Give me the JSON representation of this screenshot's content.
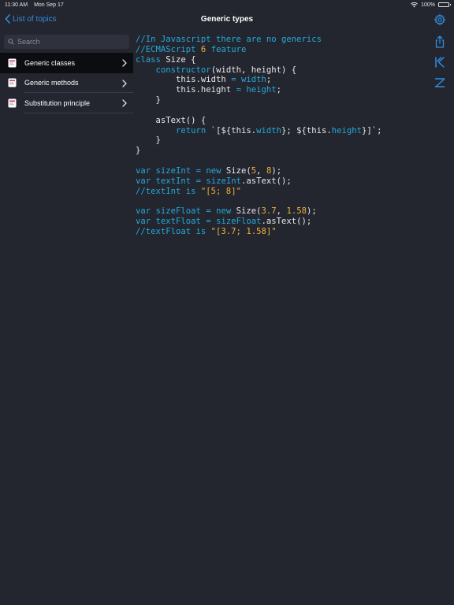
{
  "status_bar": {
    "time": "11:30 AM",
    "date": "Mon Sep 17",
    "battery": "100%"
  },
  "nav": {
    "back_label": "List of topics",
    "title": "Generic types"
  },
  "search": {
    "placeholder": "Search"
  },
  "sidebar": {
    "items": [
      {
        "label": "Generic classes",
        "selected": true
      },
      {
        "label": "Generic methods",
        "selected": false
      },
      {
        "label": "Substitution principle",
        "selected": false
      }
    ]
  },
  "code_lines": [
    [
      [
        "//In Javascript there are no generics",
        "comment"
      ]
    ],
    [
      [
        "//ECMAScript ",
        "comment"
      ],
      [
        "6",
        "num"
      ],
      [
        " feature",
        "comment"
      ]
    ],
    [
      [
        "class",
        "key"
      ],
      [
        " Size {",
        "plain"
      ]
    ],
    [
      [
        "    ",
        "plain"
      ],
      [
        "constructor",
        "key"
      ],
      [
        "(width, height) {",
        "plain"
      ]
    ],
    [
      [
        "        this.width ",
        "plain"
      ],
      [
        "=",
        "key"
      ],
      [
        " ",
        "plain"
      ],
      [
        "width",
        "key"
      ],
      [
        ";",
        "plain"
      ]
    ],
    [
      [
        "        this.height ",
        "plain"
      ],
      [
        "=",
        "key"
      ],
      [
        " ",
        "plain"
      ],
      [
        "height",
        "key"
      ],
      [
        ";",
        "plain"
      ]
    ],
    [
      [
        "    }",
        "plain"
      ]
    ],
    [
      [
        "",
        "plain"
      ]
    ],
    [
      [
        "    asText() {",
        "plain"
      ]
    ],
    [
      [
        "        ",
        "plain"
      ],
      [
        "return",
        "key"
      ],
      [
        " `[${this.",
        "plain"
      ],
      [
        "width",
        "key"
      ],
      [
        "}; ${this.",
        "plain"
      ],
      [
        "height",
        "key"
      ],
      [
        "}]`;",
        "plain"
      ]
    ],
    [
      [
        "    }",
        "plain"
      ]
    ],
    [
      [
        "}",
        "plain"
      ]
    ],
    [
      [
        "",
        "plain"
      ]
    ],
    [
      [
        "var",
        "key"
      ],
      [
        " ",
        "plain"
      ],
      [
        "sizeInt",
        "key"
      ],
      [
        " ",
        "plain"
      ],
      [
        "=",
        "key"
      ],
      [
        " ",
        "plain"
      ],
      [
        "new",
        "key"
      ],
      [
        " Size(",
        "plain"
      ],
      [
        "5",
        "num"
      ],
      [
        ", ",
        "plain"
      ],
      [
        "8",
        "num"
      ],
      [
        ");",
        "plain"
      ]
    ],
    [
      [
        "var",
        "key"
      ],
      [
        " ",
        "plain"
      ],
      [
        "textInt",
        "key"
      ],
      [
        " ",
        "plain"
      ],
      [
        "=",
        "key"
      ],
      [
        " ",
        "plain"
      ],
      [
        "sizeInt",
        "key"
      ],
      [
        ".asText();",
        "plain"
      ]
    ],
    [
      [
        "//textInt is ",
        "comment"
      ],
      [
        "\"[5; 8]\"",
        "str"
      ]
    ],
    [
      [
        "",
        "plain"
      ]
    ],
    [
      [
        "var",
        "key"
      ],
      [
        " ",
        "plain"
      ],
      [
        "sizeFloat",
        "key"
      ],
      [
        " ",
        "plain"
      ],
      [
        "=",
        "key"
      ],
      [
        " ",
        "plain"
      ],
      [
        "new",
        "key"
      ],
      [
        " Size(",
        "plain"
      ],
      [
        "3.7",
        "num"
      ],
      [
        ", ",
        "plain"
      ],
      [
        "1.58",
        "num"
      ],
      [
        ");",
        "plain"
      ]
    ],
    [
      [
        "var",
        "key"
      ],
      [
        " ",
        "plain"
      ],
      [
        "textFloat",
        "key"
      ],
      [
        " ",
        "plain"
      ],
      [
        "=",
        "key"
      ],
      [
        " ",
        "plain"
      ],
      [
        "sizeFloat",
        "key"
      ],
      [
        ".asText();",
        "plain"
      ]
    ],
    [
      [
        "//textFloat is ",
        "comment"
      ],
      [
        "\"[3.7; 1.58]\"",
        "str"
      ]
    ]
  ],
  "icons": {
    "back": "chevron-left-icon",
    "settings": "gear-icon",
    "share": "share-icon",
    "first_step": "skip-to-start-icon",
    "last_step": "skip-to-end-icon"
  },
  "colors": {
    "background": "#23252f",
    "accent": "#2f8ee0",
    "keyword": "#26a9d8",
    "number": "#f0b23a",
    "selected_row": "#0c0d11"
  }
}
